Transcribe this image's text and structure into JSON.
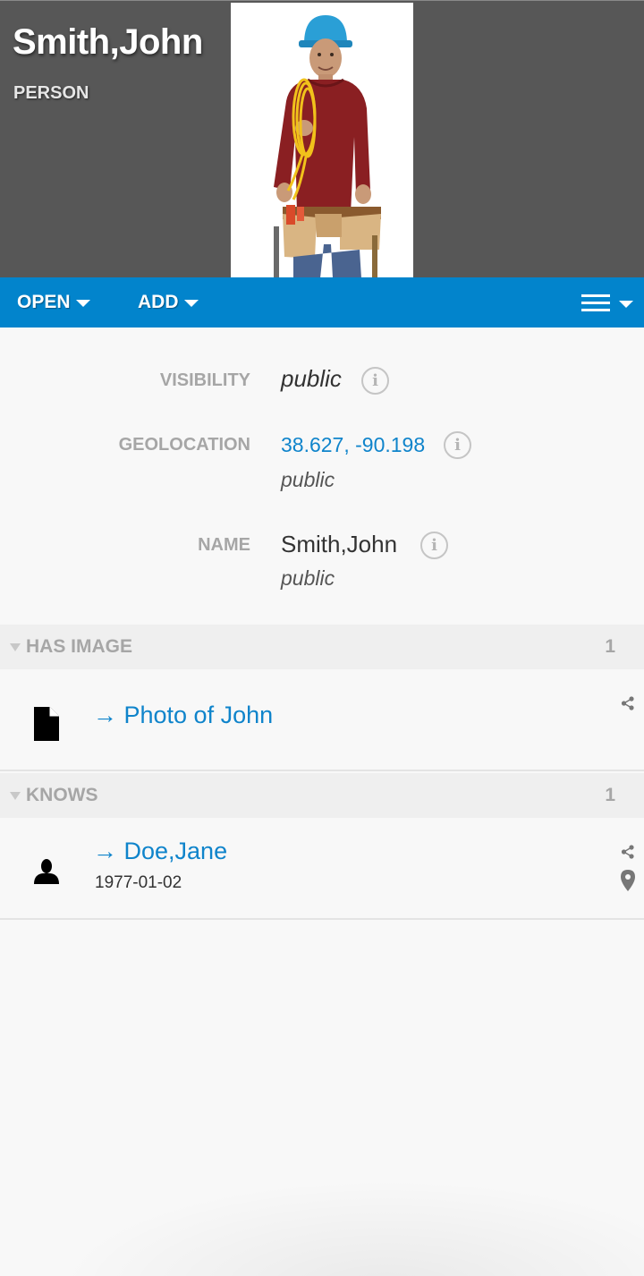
{
  "header": {
    "title": "Smith,John",
    "type_label": "PERSON",
    "photo_icon": "person-photo"
  },
  "toolbar": {
    "open_label": "OPEN",
    "add_label": "ADD",
    "menu_icon": "hamburger-icon",
    "color": "#0284cc"
  },
  "properties": [
    {
      "label": "VISIBILITY",
      "value": "public",
      "sub": ""
    },
    {
      "label": "GEOLOCATION",
      "value": "38.627, -90.198",
      "sub": "public"
    },
    {
      "label": "NAME",
      "value": "Smith,John",
      "sub": "public"
    }
  ],
  "sections": {
    "has_image": {
      "title": "HAS IMAGE",
      "count": "1",
      "items": [
        {
          "link": "→ Photo of John",
          "icon": "document-icon"
        }
      ]
    },
    "knows": {
      "title": "KNOWS",
      "count": "1",
      "items": [
        {
          "link": "→ Doe,Jane",
          "sub": "1977-01-02",
          "icon": "person-icon"
        }
      ]
    }
  },
  "colors": {
    "header_bg": "#575757",
    "link": "#0f84cb",
    "label": "#a6a6a6"
  }
}
